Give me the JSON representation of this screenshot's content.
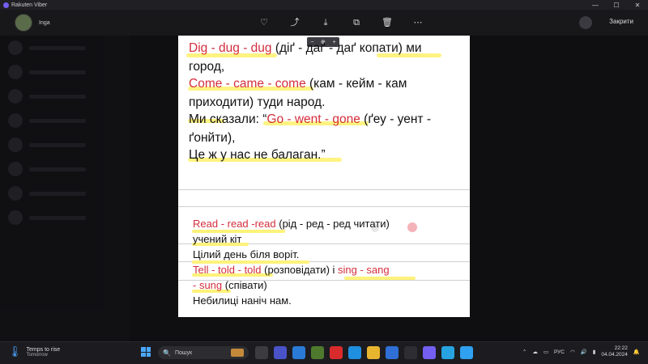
{
  "titlebar": {
    "title": "Rakuten Viber",
    "min": "—",
    "max": "☐",
    "close": "✕"
  },
  "viewer": {
    "user_name": "Inga",
    "close_label": "Закрити",
    "tools": [
      "♡",
      "⤴",
      "⤓",
      "⧉",
      "🗑",
      "⋯"
    ]
  },
  "zoom": {
    "minus": "−",
    "icon": "⊕",
    "plus": "+"
  },
  "poem": {
    "l1": {
      "a": "Dig - dug - dug",
      "b": " (діґ - даґ - даґ копати) ми"
    },
    "l2": "город,",
    "l3": {
      "a": "Come - came - come",
      "b": " (кам - кейм - кам"
    },
    "l4": "приходити) туди народ.",
    "l5": {
      "a": "Ми сказали: “",
      "b": "Go - went - gone",
      "c": " (ґеу - уент -"
    },
    "l6": "ґонйти),",
    "l7": "Це ж у нас не балаган.”"
  },
  "lower": {
    "l1": {
      "a": "Read - read -read",
      "b": " (рід - ред  - ред  читати)"
    },
    "l2": "учений кіт",
    "l3": "Цілий день біля воріт.",
    "l4": {
      "a": "Tell - told - told",
      "b": " (розповідати)  і  ",
      "c": "sing -  sang"
    },
    "l5": {
      "a": "- sung",
      "b": " (співати)"
    },
    "l6": "Небилиці наніч нам."
  },
  "taskbar": {
    "weather_line1": "Temps to rise",
    "weather_line2": "Tomorrow",
    "search_placeholder": "Пошук",
    "lang": "РУС",
    "time": "22:22",
    "date": "04.04.2024"
  }
}
